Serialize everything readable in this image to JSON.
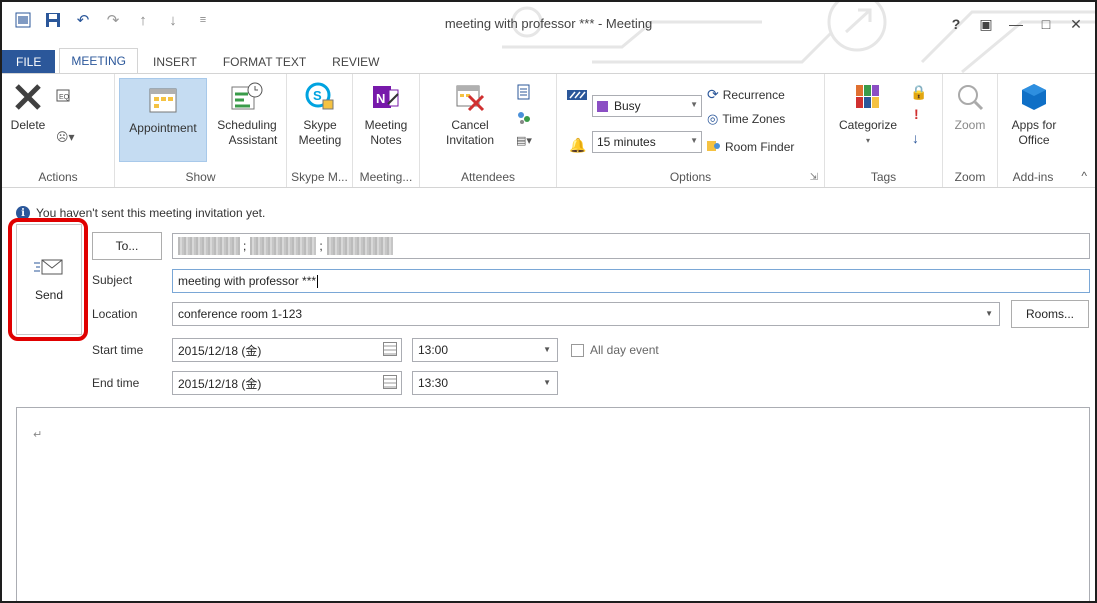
{
  "window": {
    "title": "meeting with professor *** - Meeting",
    "help": "?",
    "ribbon_display": "▣",
    "minimize": "—",
    "maximize": "□",
    "close": "✕"
  },
  "tabs": [
    {
      "label": "FILE"
    },
    {
      "label": "MEETING"
    },
    {
      "label": "INSERT"
    },
    {
      "label": "FORMAT TEXT"
    },
    {
      "label": "REVIEW"
    }
  ],
  "ribbon": {
    "actions": {
      "delete": "Delete",
      "label": "Actions"
    },
    "show": {
      "appointment": "Appointment",
      "scheduling_1": "Scheduling",
      "scheduling_2": "Assistant",
      "label": "Show"
    },
    "skype": {
      "l1": "Skype",
      "l2": "Meeting",
      "label": "Skype M..."
    },
    "meeting_notes": {
      "l1": "Meeting",
      "l2": "Notes",
      "label": "Meeting..."
    },
    "attendees": {
      "cancel_1": "Cancel",
      "cancel_2": "Invitation",
      "label": "Attendees"
    },
    "options": {
      "show_as": "Busy",
      "reminder": "15 minutes",
      "recurrence": "Recurrence",
      "time_zones": "Time Zones",
      "room_finder": "Room Finder",
      "label": "Options",
      "launcher": "⇲"
    },
    "tags": {
      "categorize": "Categorize",
      "label": "Tags"
    },
    "zoom": {
      "zoom": "Zoom",
      "label": "Zoom"
    },
    "addins": {
      "l1": "Apps for",
      "l2": "Office",
      "label": "Add-ins"
    },
    "collapse": "^"
  },
  "info_bar": "You haven't sent this meeting invitation yet.",
  "form": {
    "send": "Send",
    "to_button": "To...",
    "subject_label": "Subject",
    "subject_value": "meeting with professor ***",
    "location_label": "Location",
    "location_value": "conference room 1-123",
    "rooms_button": "Rooms...",
    "start_label": "Start time",
    "start_date": "2015/12/18 (金)",
    "start_time": "13:00",
    "all_day": "All day event",
    "end_label": "End time",
    "end_date": "2015/12/18 (金)",
    "end_time": "13:30"
  },
  "body_mark": "↵",
  "colors": {
    "accent": "#2b579a",
    "highlight": "#e00000"
  }
}
